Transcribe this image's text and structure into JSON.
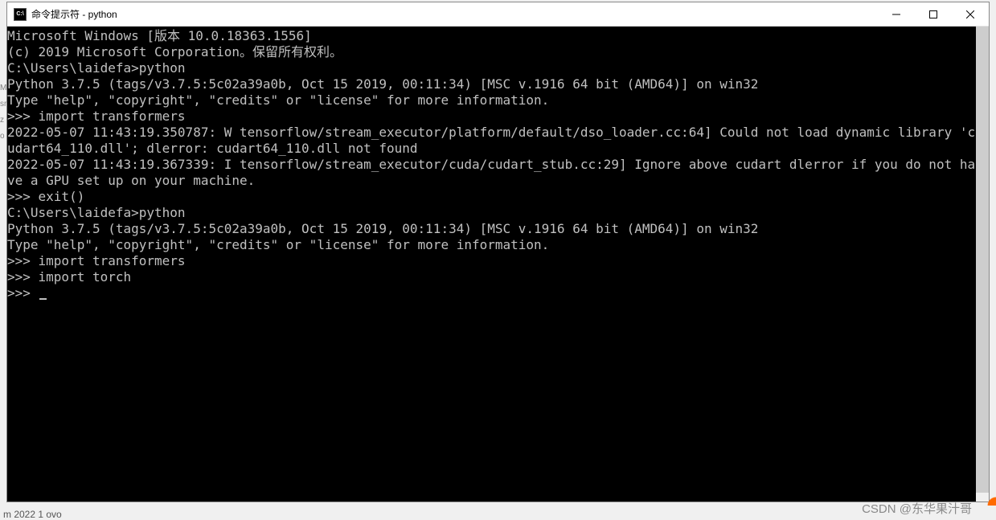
{
  "titlebar": {
    "icon_label": "C:\\",
    "title": "命令提示符 - python"
  },
  "terminal": {
    "lines": [
      "Microsoft Windows [版本 10.0.18363.1556]",
      "(c) 2019 Microsoft Corporation。保留所有权利。",
      "",
      "C:\\Users\\laidefa>python",
      "Python 3.7.5 (tags/v3.7.5:5c02a39a0b, Oct 15 2019, 00:11:34) [MSC v.1916 64 bit (AMD64)] on win32",
      "Type \"help\", \"copyright\", \"credits\" or \"license\" for more information.",
      ">>> import transformers",
      "2022-05-07 11:43:19.350787: W tensorflow/stream_executor/platform/default/dso_loader.cc:64] Could not load dynamic library 'cudart64_110.dll'; dlerror: cudart64_110.dll not found",
      "2022-05-07 11:43:19.367339: I tensorflow/stream_executor/cuda/cudart_stub.cc:29] Ignore above cudart dlerror if you do not have a GPU set up on your machine.",
      ">>> exit()",
      "",
      "C:\\Users\\laidefa>python",
      "Python 3.7.5 (tags/v3.7.5:5c02a39a0b, Oct 15 2019, 00:11:34) [MSC v.1916 64 bit (AMD64)] on win32",
      "Type \"help\", \"copyright\", \"credits\" or \"license\" for more information.",
      ">>> import transformers",
      ">>> import torch",
      ">>> "
    ]
  },
  "left_edge_chars": [
    "M",
    "",
    "",
    "sr",
    "z",
    "o"
  ],
  "watermark": "CSDN @东华果汁哥",
  "bottom_partial": "m 2022 1 ovo"
}
